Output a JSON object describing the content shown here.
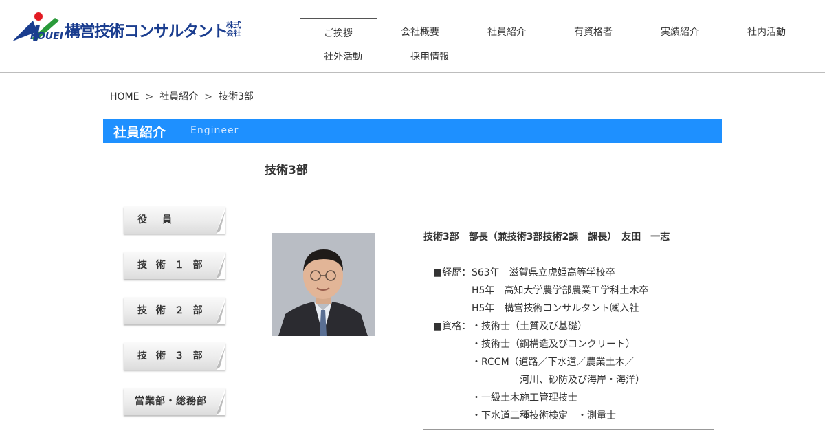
{
  "brand": {
    "logo_text": "KOUEI",
    "company_name": "構営技術コンサルタント",
    "company_suffix": "株式会社",
    "colors": {
      "blue": "#1a3d8f",
      "red": "#e21b23",
      "green": "#2a9a3a",
      "accent_bar": "#1e90ff"
    }
  },
  "nav": {
    "items": [
      {
        "label": "ご挨拶",
        "active": true
      },
      {
        "label": "会社概要"
      },
      {
        "label": "社員紹介"
      },
      {
        "label": "有資格者"
      },
      {
        "label": "実績紹介"
      },
      {
        "label": "社内活動"
      },
      {
        "label": "社外活動"
      },
      {
        "label": "採用情報"
      }
    ]
  },
  "breadcrumb": {
    "items": [
      "HOME",
      "社員紹介",
      "技術3部"
    ],
    "separator": ">"
  },
  "section": {
    "title": "社員紹介",
    "subtitle": "Engineer"
  },
  "department_heading": "技術3部",
  "side_menu": {
    "items": [
      {
        "label": "役　員"
      },
      {
        "label": "技 術 １ 部"
      },
      {
        "label": "技 術 ２ 部"
      },
      {
        "label": "技 術 ３ 部"
      },
      {
        "label": "営業部・総務部"
      }
    ]
  },
  "profile": {
    "photo_icon": "person-photo",
    "name_line": "技術3部　部長（兼技術3部技術2課　課長）　友田　一志",
    "history_label": "■経歴：",
    "history": [
      "S63年　滋賀県立虎姫高等学校卒",
      "H5年　高知大学農学部農業工学科土木卒",
      "H5年　構営技術コンサルタント㈱入社"
    ],
    "qual_label": "■資格：",
    "qualifications": [
      "・技術士（土質及び基礎）",
      "・技術士（鋼構造及びコンクリート）",
      "・RCCM（道路／下水道／農業土木／",
      "河川、砂防及び海岸・海洋）",
      "・一級土木施工管理技士",
      "・下水道二種技術検定　・測量士"
    ]
  }
}
